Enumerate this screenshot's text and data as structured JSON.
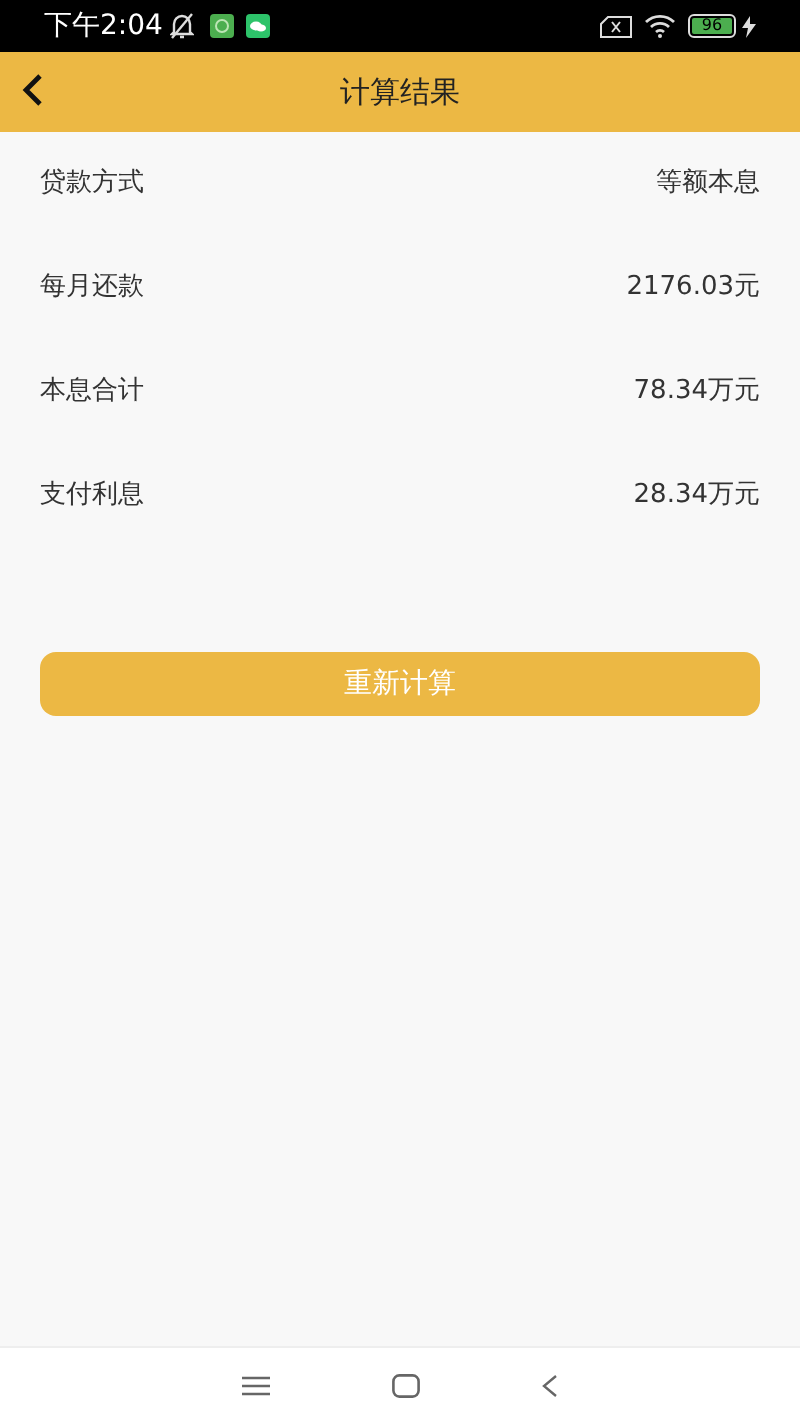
{
  "status_bar": {
    "time": "下午2:04",
    "battery": "96"
  },
  "header": {
    "title": "计算结果"
  },
  "results": [
    {
      "label": "贷款方式",
      "value": "等额本息"
    },
    {
      "label": "每月还款",
      "value": "2176.03元"
    },
    {
      "label": "本息合计",
      "value": "78.34万元"
    },
    {
      "label": "支付利息",
      "value": "28.34万元"
    }
  ],
  "recalculate_button": "重新计算"
}
